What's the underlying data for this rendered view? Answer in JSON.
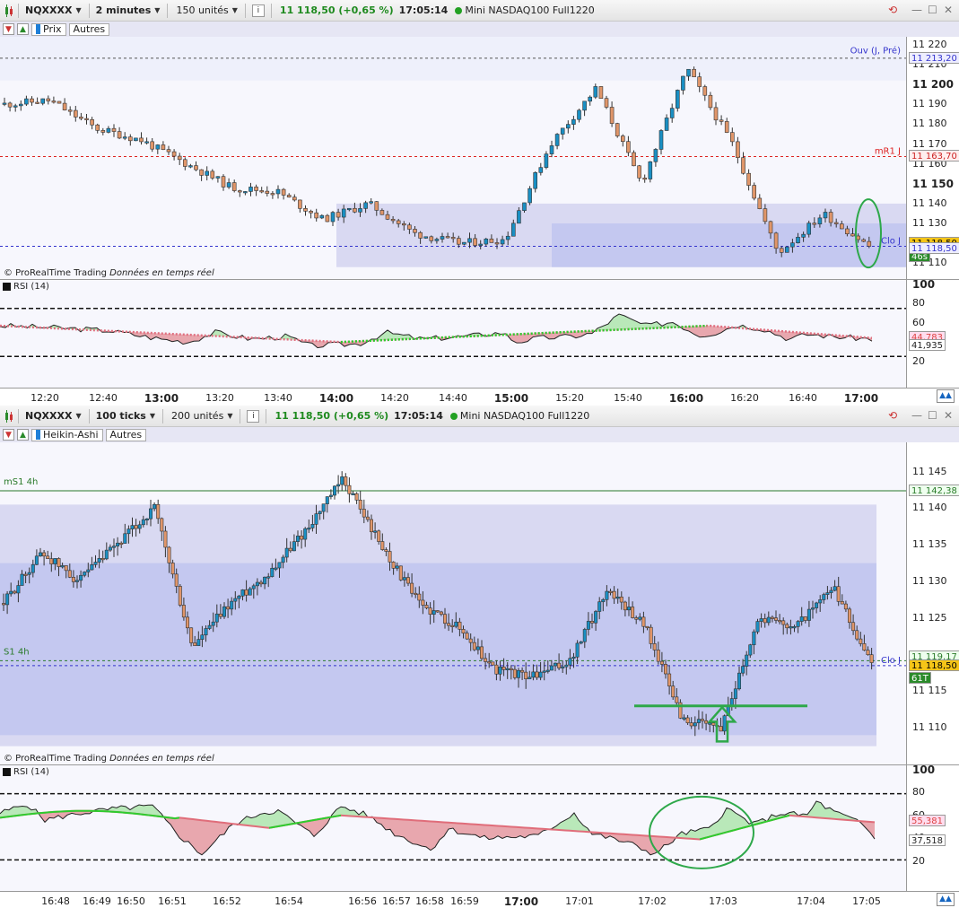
{
  "colors": {
    "up": "#1a8fc3",
    "down": "#e0966a",
    "rsi_up": "#b9e8b9",
    "rsi_down": "#e8a7ae",
    "band_outer": "#d9d9f2",
    "band_inner": "#c4c8f0",
    "highlight": "#2ea84a"
  },
  "top": {
    "toolbar": {
      "symbol": "NQXXXX",
      "interval": "2 minutes",
      "units": "150 unités",
      "price": "11 118,50 (+0,65 %)",
      "time": "17:05:14",
      "instrument": "Mini NASDAQ100 Full1220"
    },
    "tabs": {
      "price": "Prix",
      "others": "Autres"
    },
    "copyright": "© ProRealTime Trading",
    "copyright_live": "Données en temps réel",
    "yaxis": [
      "11 220",
      "11 210",
      "11 200",
      "11 190",
      "11 180",
      "11 170",
      "11 160",
      "11 150",
      "11 140",
      "11 130",
      "11 120",
      "11 110"
    ],
    "ymin": 11102,
    "ymax": 11224,
    "tags": {
      "open": "11 213,20",
      "mr1": "11 163,70",
      "last": "11 118,50",
      "last_time": "46s",
      "close": "11 118,50"
    },
    "level_labels": {
      "open": "Ouv (J, Pré)",
      "mr1": "mR1 J",
      "close": "Clo J"
    },
    "levels": {
      "open": 11213.2,
      "mr1": 11163.7,
      "close": 11118.5
    },
    "rsi": {
      "title": "RSI (14)",
      "y": [
        "100",
        "80",
        "60",
        "40",
        "20"
      ],
      "rsi_value": "41,935",
      "ma_value": "44,783"
    },
    "xaxis": [
      "12:20",
      "12:40",
      "13:00",
      "13:20",
      "13:40",
      "14:00",
      "14:20",
      "14:40",
      "15:00",
      "15:20",
      "15:40",
      "16:00",
      "16:20",
      "16:40",
      "17:00"
    ]
  },
  "bottom": {
    "toolbar": {
      "symbol": "NQXXXX",
      "interval": "100 ticks",
      "units": "200 unités",
      "price": "11 118,50 (+0,65 %)",
      "time": "17:05:14",
      "instrument": "Mini NASDAQ100 Full1220"
    },
    "tabs": {
      "price": "Heikin-Ashi",
      "others": "Autres"
    },
    "copyright": "© ProRealTime Trading",
    "copyright_live": "Données en temps réel",
    "yaxis": [
      "11 145",
      "11 140",
      "11 135",
      "11 130",
      "11 125",
      "11 120",
      "11 115",
      "11 110"
    ],
    "ymin": 11105,
    "ymax": 11149,
    "tags": {
      "ms1": "11 142,38",
      "s1": "11 119,17",
      "last": "11 118,50",
      "last_ticks": "61T"
    },
    "level_labels": {
      "ms1": "mS1 4h",
      "s1": "S1 4h",
      "close": "Clo J"
    },
    "levels": {
      "ms1": 11142.38,
      "s1": 11119.17,
      "close": 11118.5
    },
    "rsi": {
      "title": "RSI (14)",
      "y": [
        "100",
        "80",
        "60",
        "40",
        "20"
      ],
      "ma_value": "55,381",
      "rsi_value": "37,518"
    },
    "xaxis": [
      "16:48",
      "16:49",
      "16:50",
      "16:51",
      "16:52",
      "16:54",
      "16:56",
      "16:57",
      "16:58",
      "16:59",
      "17:00",
      "17:01",
      "17:02",
      "17:03",
      "17:04",
      "17:05"
    ]
  },
  "chart_data": [
    {
      "type": "candlestick",
      "title": "NQXXXX 2 minutes",
      "x": [
        "12:20",
        "12:40",
        "13:00",
        "13:20",
        "13:40",
        "14:00",
        "14:20",
        "14:40",
        "15:00",
        "15:20",
        "15:40",
        "16:00",
        "16:20",
        "16:40",
        "17:00"
      ],
      "close": [
        11190,
        11192,
        11178,
        11172,
        11160,
        11148,
        11146,
        11132,
        11140,
        11125,
        11120,
        11122,
        11170,
        11198,
        11150,
        11208,
        11170,
        11115,
        11135,
        11118.5
      ],
      "ylim": [
        11102,
        11224
      ]
    },
    {
      "type": "candlestick",
      "title": "NQXXXX 100 ticks Heikin-Ashi",
      "x": [
        "16:48",
        "16:49",
        "16:50",
        "16:51",
        "16:52",
        "16:54",
        "16:56",
        "16:57",
        "16:58",
        "16:59",
        "17:00",
        "17:01",
        "17:02",
        "17:03",
        "17:04",
        "17:05"
      ],
      "close": [
        11127,
        11134,
        11130,
        11135,
        11140,
        11121,
        11127,
        11131,
        11137,
        11144,
        11135,
        11127,
        11124,
        11118,
        11117,
        11119,
        11129,
        11124,
        11111,
        11110,
        11125,
        11124,
        11129,
        11118.5
      ],
      "ylim": [
        11105,
        11149
      ]
    }
  ]
}
